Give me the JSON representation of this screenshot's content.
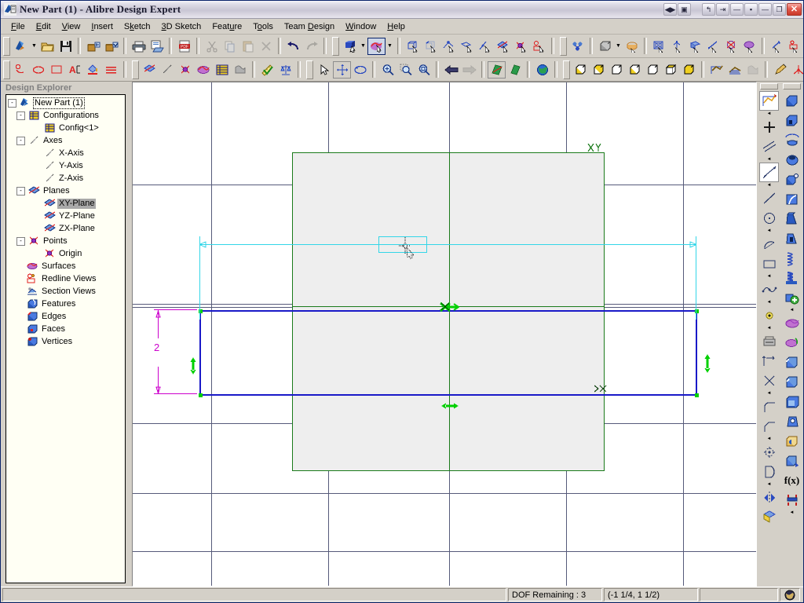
{
  "window": {
    "title": "New Part (1) - Alibre Design Expert",
    "app_icon": "alibre-logo-icon",
    "buttons": {
      "nav_left_right": "◀▶",
      "restore_doc": "▣",
      "undo_dock": "↰",
      "pin": "⇥",
      "minimize_doc": "—",
      "restore_small": "▪",
      "minimize": "—",
      "restore": "❐",
      "close": "✕"
    }
  },
  "menubar": {
    "items": [
      {
        "label": "File",
        "accel": "F"
      },
      {
        "label": "Edit",
        "accel": "E"
      },
      {
        "label": "View",
        "accel": "V"
      },
      {
        "label": "Insert",
        "accel": "I"
      },
      {
        "label": "Sketch",
        "accel": "k"
      },
      {
        "label": "3D Sketch",
        "accel": "3"
      },
      {
        "label": "Feature",
        "accel": "u"
      },
      {
        "label": "Tools",
        "accel": "o"
      },
      {
        "label": "Team Design",
        "accel": "D"
      },
      {
        "label": "Window",
        "accel": "W"
      },
      {
        "label": "Help",
        "accel": "H"
      }
    ]
  },
  "toolbar_row1": {
    "groups": [
      {
        "name": "standard",
        "buttons": [
          {
            "name": "new-part-button",
            "label": "New"
          },
          {
            "name": "new-part-dropdown",
            "label": "New dropdown"
          },
          {
            "name": "open-button",
            "label": "Open"
          },
          {
            "name": "save-button",
            "label": "Save"
          },
          {
            "name": "checkout-button",
            "label": "Check Out"
          },
          {
            "name": "checkin-button",
            "label": "Check In"
          },
          {
            "name": "print-button",
            "label": "Print"
          },
          {
            "name": "print-preview-button",
            "label": "Print Preview"
          },
          {
            "name": "export-pdf-button",
            "label": "Publish to PDF"
          },
          {
            "name": "cut-button",
            "label": "Cut",
            "disabled": true
          },
          {
            "name": "copy-button",
            "label": "Copy",
            "disabled": true
          },
          {
            "name": "paste-button",
            "label": "Paste",
            "disabled": true
          },
          {
            "name": "delete-button",
            "label": "Delete",
            "disabled": true
          },
          {
            "name": "undo-button",
            "label": "Undo"
          },
          {
            "name": "redo-button",
            "label": "Redo",
            "disabled": true
          }
        ]
      },
      {
        "name": "select",
        "buttons": [
          {
            "name": "select-button",
            "label": "Select"
          },
          {
            "name": "select-dropdown",
            "label": "Select dropdown"
          },
          {
            "name": "color-button",
            "label": "Color / Appearance",
            "selected": true
          },
          {
            "name": "color-dropdown",
            "label": "Color dropdown"
          },
          {
            "name": "select-face-button",
            "label": "Select Face"
          },
          {
            "name": "select-edge-button",
            "label": "Select Edge"
          },
          {
            "name": "select-vertex-button",
            "label": "Select Vertex"
          },
          {
            "name": "select-plane-button",
            "label": "Select Plane"
          },
          {
            "name": "select-axis-button",
            "label": "Select Axis"
          },
          {
            "name": "select-sketch-button",
            "label": "Select Sketch"
          },
          {
            "name": "select-point-button",
            "label": "Select Point"
          },
          {
            "name": "select-annotation-button",
            "label": "Select Annotation"
          }
        ]
      },
      {
        "name": "assembly",
        "buttons": [
          {
            "name": "team-design-button",
            "label": "Team Design"
          },
          {
            "name": "extrude-boss-button",
            "label": "Extrude Boss"
          },
          {
            "name": "extrude-dropdown",
            "label": "Extrude dropdown"
          },
          {
            "name": "revolve-boss-button",
            "label": "Revolve Boss"
          },
          {
            "name": "sweep-boss-button",
            "label": "Sweep Boss"
          },
          {
            "name": "loft-boss-button",
            "label": "Loft Boss"
          },
          {
            "name": "fillet-button",
            "label": "Fillet"
          },
          {
            "name": "chamfer-button",
            "label": "Chamfer"
          },
          {
            "name": "shell-button",
            "label": "Shell"
          },
          {
            "name": "draft-button",
            "label": "Draft"
          },
          {
            "name": "hole-button",
            "label": "Hole"
          },
          {
            "name": "thread-button",
            "label": "Thread"
          },
          {
            "name": "bend-button",
            "label": "Bend"
          },
          {
            "name": "pattern-rect-button",
            "label": "Rectangular Pattern"
          },
          {
            "name": "pattern-circ-button",
            "label": "Circular Pattern"
          },
          {
            "name": "mirror-feature-button",
            "label": "Mirror Feature"
          }
        ]
      }
    ]
  },
  "toolbar_row2": {
    "groups": [
      {
        "name": "sketch-annotate",
        "buttons": [
          {
            "name": "note-button",
            "label": "Note"
          },
          {
            "name": "ellipse-annotation-button",
            "label": "Ellipse"
          },
          {
            "name": "rectangle-annotation-button",
            "label": "Rectangle"
          },
          {
            "name": "text-button",
            "label": "Text"
          },
          {
            "name": "fill-button",
            "label": "Fill"
          },
          {
            "name": "line-style-button",
            "label": "Line Style"
          }
        ]
      },
      {
        "name": "visibility",
        "buttons": [
          {
            "name": "show-planes-button",
            "label": "Show Planes"
          },
          {
            "name": "show-axes-button",
            "label": "Show Axes"
          },
          {
            "name": "show-points-button",
            "label": "Show Points"
          },
          {
            "name": "show-surfaces-button",
            "label": "Show Surfaces"
          },
          {
            "name": "show-grid-button",
            "label": "Show Grid"
          },
          {
            "name": "show-shaded-button",
            "label": "Shaded"
          },
          {
            "name": "measure-button",
            "label": "Measure"
          },
          {
            "name": "physical-properties-button",
            "label": "Physical Properties"
          }
        ]
      },
      {
        "name": "view-nav",
        "buttons": [
          {
            "name": "pointer-button",
            "label": "Pointer"
          },
          {
            "name": "pan-button",
            "label": "Pan",
            "boxed": true
          },
          {
            "name": "rotate-button",
            "label": "Rotate"
          },
          {
            "name": "zoom-in-button",
            "label": "Zoom In"
          },
          {
            "name": "zoom-window-button",
            "label": "Zoom Window"
          },
          {
            "name": "zoom-fit-button",
            "label": "Zoom To Fit"
          },
          {
            "name": "previous-view-button",
            "label": "Previous View"
          },
          {
            "name": "next-view-button",
            "label": "Next View",
            "disabled": true
          },
          {
            "name": "sketch-view-button",
            "label": "Sketch View",
            "boxed": true
          },
          {
            "name": "normal-to-button",
            "label": "Normal To"
          },
          {
            "name": "global-view-button",
            "label": "Global View"
          }
        ]
      },
      {
        "name": "standard-views",
        "buttons": [
          {
            "name": "view-iso-button",
            "label": "Isometric View"
          },
          {
            "name": "view-trimetric-button",
            "label": "Trimetric View"
          },
          {
            "name": "view-dimetric-button",
            "label": "Dimetric View"
          },
          {
            "name": "view-front-button",
            "label": "Front View"
          },
          {
            "name": "view-back-button",
            "label": "Back View"
          },
          {
            "name": "view-top-button",
            "label": "Top View"
          },
          {
            "name": "view-right-button",
            "label": "Right View"
          },
          {
            "name": "wireframe-button",
            "label": "Wireframe"
          },
          {
            "name": "hidden-line-button",
            "label": "Hidden Line"
          },
          {
            "name": "shaded-render-button",
            "label": "Shaded Render",
            "disabled": true
          },
          {
            "name": "edit-sketch-button",
            "label": "Edit Sketch"
          },
          {
            "name": "sketch-constraints-button",
            "label": "Sketch Constraints"
          }
        ]
      }
    ]
  },
  "explorer": {
    "title": "Design Explorer",
    "tree": [
      {
        "label": "New Part (1)",
        "depth": 0,
        "expander": "-",
        "icon": "part-icon",
        "focus": true
      },
      {
        "label": "Configurations",
        "depth": 1,
        "expander": "-",
        "icon": "configurations-icon"
      },
      {
        "label": "Config<1>",
        "depth": 3,
        "expander": "",
        "icon": "config-icon"
      },
      {
        "label": "Axes",
        "depth": 1,
        "expander": "-",
        "icon": "axes-icon"
      },
      {
        "label": "X-Axis",
        "depth": 3,
        "expander": "",
        "icon": "axis-icon"
      },
      {
        "label": "Y-Axis",
        "depth": 3,
        "expander": "",
        "icon": "axis-icon"
      },
      {
        "label": "Z-Axis",
        "depth": 3,
        "expander": "",
        "icon": "axis-icon"
      },
      {
        "label": "Planes",
        "depth": 1,
        "expander": "-",
        "icon": "planes-icon"
      },
      {
        "label": "XY-Plane",
        "depth": 3,
        "expander": "",
        "icon": "plane-icon",
        "selected": true
      },
      {
        "label": "YZ-Plane",
        "depth": 3,
        "expander": "",
        "icon": "plane-icon"
      },
      {
        "label": "ZX-Plane",
        "depth": 3,
        "expander": "",
        "icon": "plane-icon"
      },
      {
        "label": "Points",
        "depth": 1,
        "expander": "-",
        "icon": "points-icon"
      },
      {
        "label": "Origin",
        "depth": 3,
        "expander": "",
        "icon": "origin-icon"
      },
      {
        "label": "Surfaces",
        "depth": 1,
        "expander": "",
        "icon": "surfaces-icon"
      },
      {
        "label": "Redline Views",
        "depth": 1,
        "expander": "",
        "icon": "redline-views-icon"
      },
      {
        "label": "Section Views",
        "depth": 1,
        "expander": "",
        "icon": "section-views-icon"
      },
      {
        "label": "Features",
        "depth": 1,
        "expander": "",
        "icon": "features-icon"
      },
      {
        "label": "Edges",
        "depth": 1,
        "expander": "",
        "icon": "edges-icon"
      },
      {
        "label": "Faces",
        "depth": 1,
        "expander": "",
        "icon": "faces-icon"
      },
      {
        "label": "Vertices",
        "depth": 1,
        "expander": "",
        "icon": "vertices-icon"
      }
    ]
  },
  "canvas": {
    "plane_label": "XY",
    "dimension_vertical_value": "2",
    "dimension_horizontal_value": "",
    "colors": {
      "grid": "#565a7a",
      "plane_outline": "#1a7a1a",
      "plane_fill": "#eeeeee",
      "sketch_line": "#1919c8",
      "dimension_active": "#33d6e8",
      "dimension_placed": "#cc00cc",
      "constraint": "#00d000"
    }
  },
  "vtoolbar_left": {
    "buttons": [
      {
        "name": "sketch-mode-button",
        "label": "Activate 2D Sketch",
        "selected": true
      },
      {
        "name": "point-tool-button",
        "label": "Point"
      },
      {
        "name": "line-tool-button",
        "label": "Line"
      },
      {
        "name": "dimension-tool-button",
        "label": "Dimension",
        "selected": true
      },
      {
        "name": "single-line-tool-button",
        "label": "Single Line"
      },
      {
        "name": "circle-tool-button",
        "label": "Circle"
      },
      {
        "name": "arc-tool-button",
        "label": "Arc"
      },
      {
        "name": "rectangle-tool-button",
        "label": "Rectangle"
      },
      {
        "name": "spline-tool-button",
        "label": "Spline"
      },
      {
        "name": "reference-point-button",
        "label": "Reference Point"
      },
      {
        "name": "project-to-sketch-button",
        "label": "Project to Sketch"
      },
      {
        "name": "offset-tool-button",
        "label": "Offset"
      },
      {
        "name": "trim-tool-button",
        "label": "Trim"
      },
      {
        "name": "fillet-2d-button",
        "label": "Sketch Fillet"
      },
      {
        "name": "chamfer-2d-button",
        "label": "Sketch Chamfer"
      },
      {
        "name": "pattern-2d-button",
        "label": "Sketch Pattern"
      },
      {
        "name": "closed-region-button",
        "label": "Closed Region"
      },
      {
        "name": "mirror-2d-button",
        "label": "Mirror Sketch"
      },
      {
        "name": "sketch-figure-button",
        "label": "Sketch Figure"
      }
    ]
  },
  "vtoolbar_right": {
    "buttons": [
      {
        "name": "extrude-boss-button",
        "label": "Extrude Boss"
      },
      {
        "name": "extrude-cut-button",
        "label": "Extrude Cut"
      },
      {
        "name": "revolve-boss-button",
        "label": "Revolve Boss"
      },
      {
        "name": "revolve-cut-button",
        "label": "Revolve Cut"
      },
      {
        "name": "sweep-boss-button",
        "label": "Sweep Boss"
      },
      {
        "name": "sweep-cut-button",
        "label": "Sweep Cut"
      },
      {
        "name": "loft-boss-button",
        "label": "Loft Boss"
      },
      {
        "name": "loft-cut-button",
        "label": "Loft Cut"
      },
      {
        "name": "helical-boss-button",
        "label": "Helical Boss"
      },
      {
        "name": "helical-cut-button",
        "label": "Helical Cut"
      },
      {
        "name": "boolean-add-button",
        "label": "Boolean Add"
      },
      {
        "name": "surface-button",
        "label": "Surface"
      },
      {
        "name": "surface-offset-button",
        "label": "Offset Surface"
      },
      {
        "name": "fillet-button",
        "label": "Fillet"
      },
      {
        "name": "chamfer-button",
        "label": "Chamfer"
      },
      {
        "name": "shell-button",
        "label": "Shell"
      },
      {
        "name": "draft-button",
        "label": "Draft"
      },
      {
        "name": "hole-button",
        "label": "Hole"
      },
      {
        "name": "insert-part-button",
        "label": "Insert Part"
      },
      {
        "name": "equation-button",
        "label": "f(x) Equations"
      },
      {
        "name": "constraint-button",
        "label": "Constraints"
      }
    ]
  },
  "statusbar": {
    "message": "",
    "dof": "DOF Remaining : 3",
    "coordinates": "(-1 1/4, 1 1/2)",
    "extra": "",
    "globe_icon": "globe-icon"
  }
}
